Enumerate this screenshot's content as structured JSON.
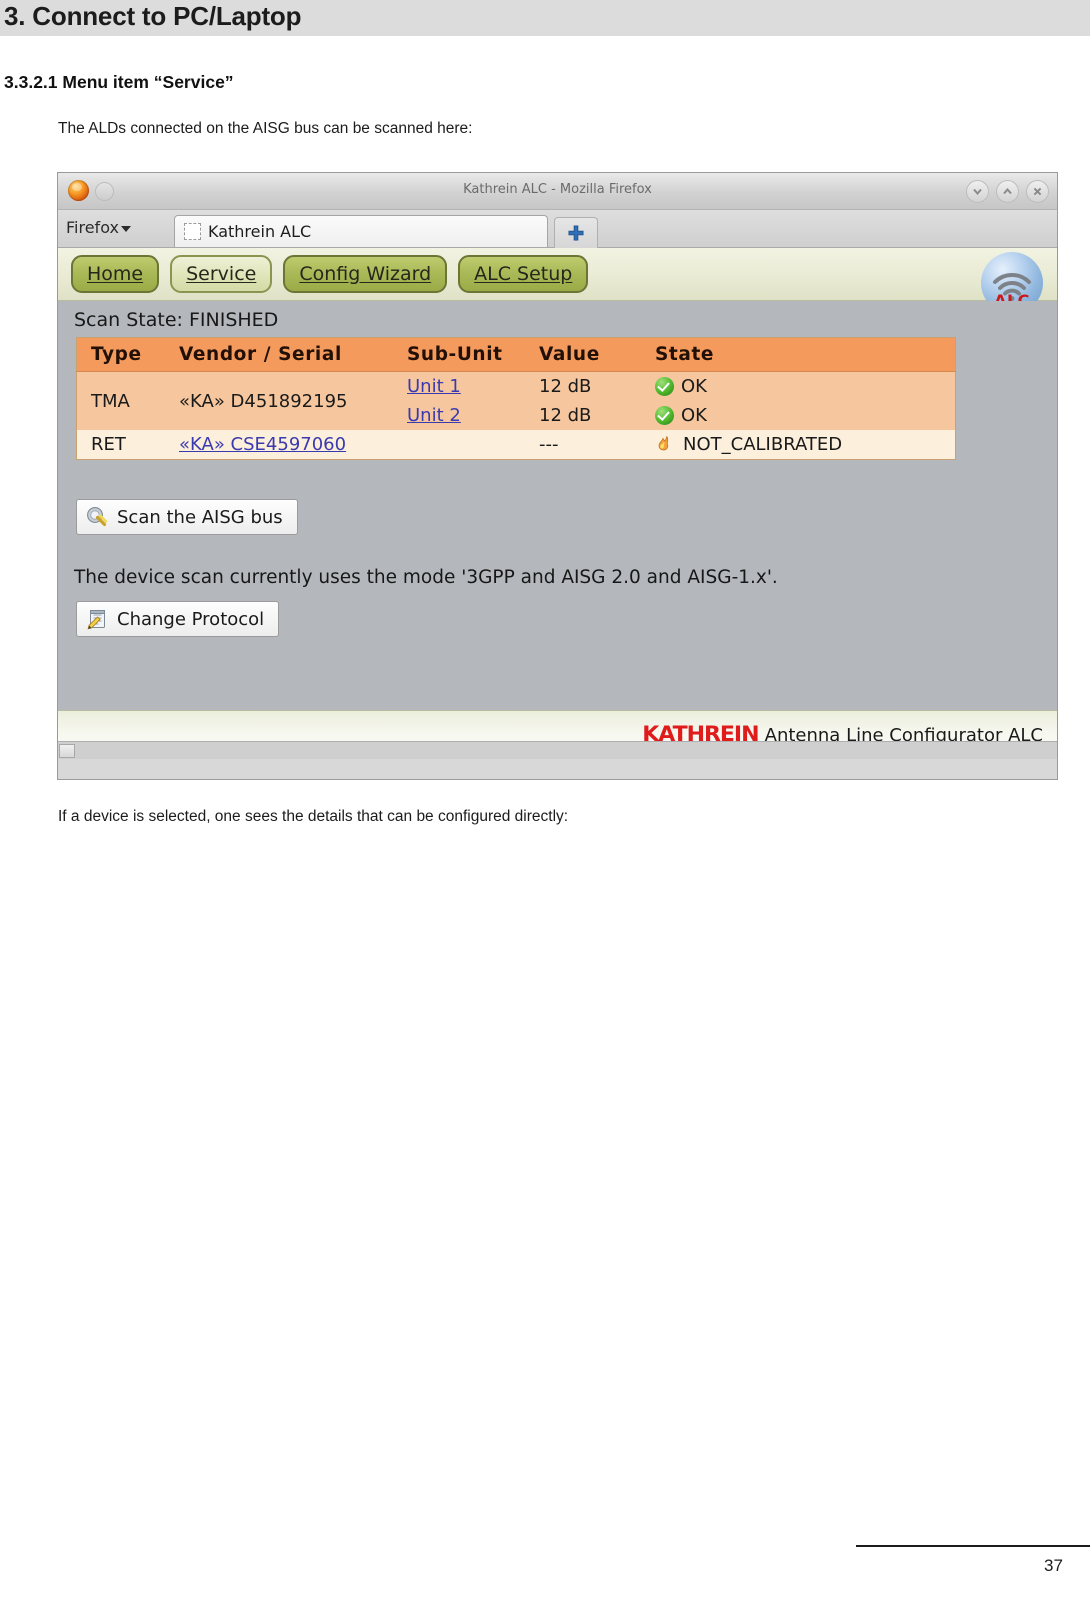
{
  "document": {
    "header_title": "3. Connect to PC/Laptop",
    "section_heading": "3.3.2.1 Menu item “Service”",
    "intro_text": "The ALDs connected on the AISG bus can be scanned here:",
    "outro_text": "If a device is selected, one sees the details that can be configured directly:",
    "page_number": "37"
  },
  "browser": {
    "window_title": "Kathrein ALC - Mozilla Firefox",
    "firefox_menu_label": "Firefox",
    "tab_label": "Kathrein ALC",
    "new_tab_label": "+",
    "window_buttons": [
      {
        "name": "minimize",
        "glyph": "chevron-down"
      },
      {
        "name": "maximize",
        "glyph": "chevron-up"
      },
      {
        "name": "close",
        "glyph": "cross"
      }
    ]
  },
  "app": {
    "nav_buttons": [
      {
        "label": "Home",
        "active": false
      },
      {
        "label": "Service",
        "active": true
      },
      {
        "label": "Config Wizard",
        "active": false
      },
      {
        "label": "ALC Setup",
        "active": false
      }
    ],
    "logo_text": "ALC",
    "scan_state_label": "Scan State:",
    "scan_state_value": "FINISHED",
    "table": {
      "headers": [
        "Type",
        "Vendor / Serial",
        "Sub-Unit",
        "Value",
        "State"
      ],
      "rows": [
        {
          "type": "TMA",
          "vendor": "«KA» D451892195",
          "vendor_is_link": false,
          "subunits": [
            {
              "sub": "Unit 1",
              "value": "12 dB",
              "state": "OK",
              "badge": "ok"
            },
            {
              "sub": "Unit 2",
              "value": "12 dB",
              "state": "OK",
              "badge": "ok"
            }
          ]
        },
        {
          "type": "RET",
          "vendor": "«KA» CSE4597060",
          "vendor_is_link": true,
          "subunits": [
            {
              "sub": "",
              "value": "---",
              "state": "NOT_CALIBRATED",
              "badge": "warn"
            }
          ]
        }
      ]
    },
    "scan_button_label": "Scan the AISG bus",
    "protocol_note": "The device scan currently uses the mode '3GPP and AISG 2.0 and AISG-1.x'.",
    "change_protocol_label": "Change Protocol",
    "footer_brand": "KATHREIN",
    "footer_text": "Antenna Line Configurator ALC"
  },
  "colors": {
    "header_band": "#dcdcdc",
    "table_header": "#f49a5c",
    "row_a": "#f6c79e",
    "row_b": "#fcefdc",
    "nav_button": "#a9b957",
    "nav_button_active": "#dfe5b8",
    "link": "#3a3ab0",
    "brand_red": "#e01b1b",
    "ok_green": "#4cb62b"
  }
}
